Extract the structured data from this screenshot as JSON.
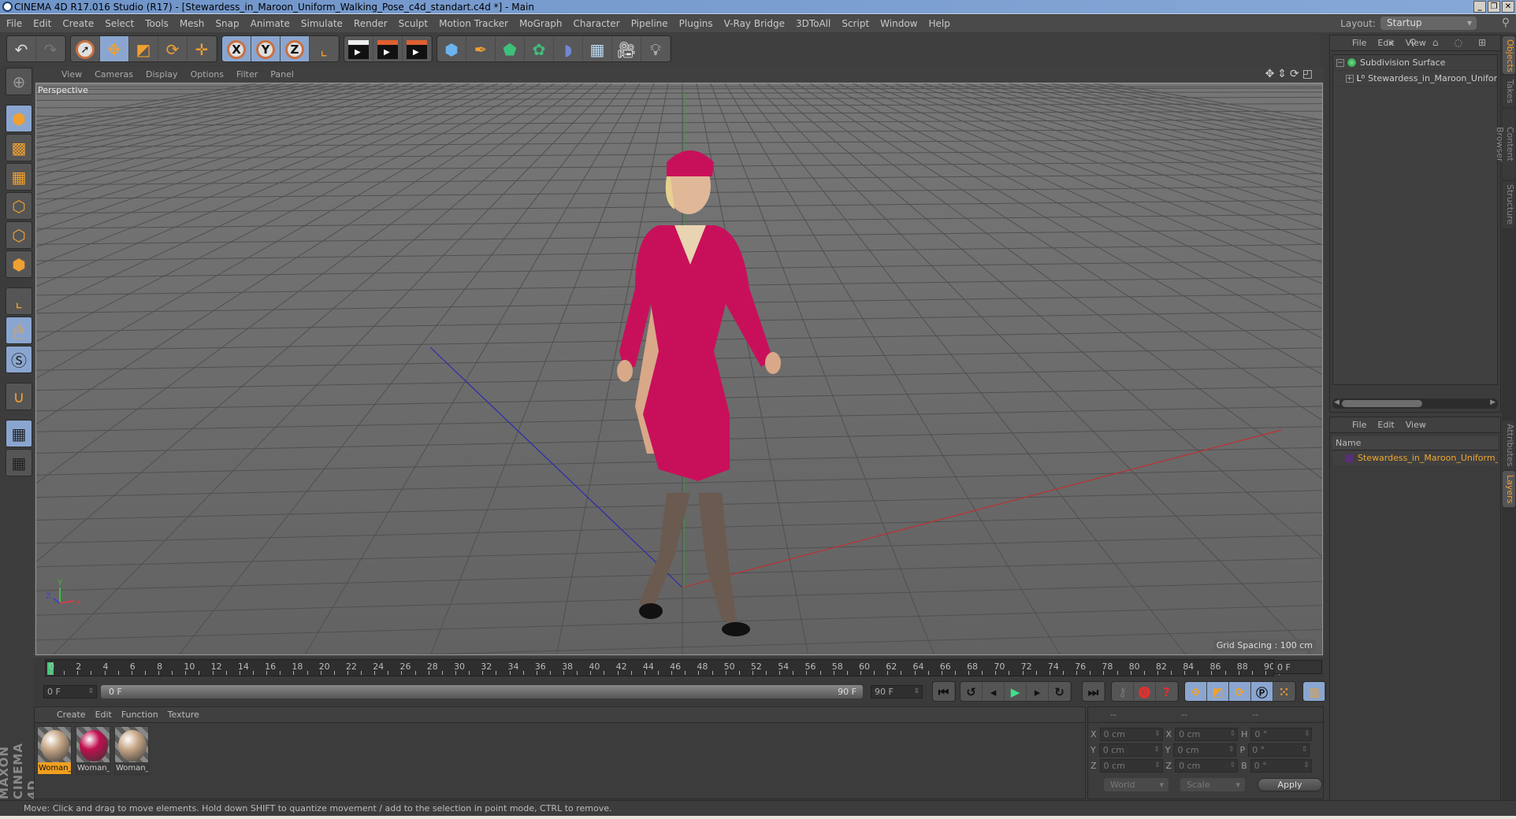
{
  "window": {
    "title": "CINEMA 4D R17.016 Studio (R17) - [Stewardess_in_Maroon_Uniform_Walking_Pose_c4d_standart.c4d *] - Main",
    "controls": [
      "_",
      "❐",
      "✕"
    ]
  },
  "menubar": {
    "items": [
      "File",
      "Edit",
      "Create",
      "Select",
      "Tools",
      "Mesh",
      "Snap",
      "Animate",
      "Simulate",
      "Render",
      "Sculpt",
      "Motion Tracker",
      "MoGraph",
      "Character",
      "Pipeline",
      "Plugins",
      "V-Ray Bridge",
      "3DToAll",
      "Script",
      "Window",
      "Help"
    ],
    "layout_label": "Layout:",
    "layout_value": "Startup"
  },
  "toolbar": {
    "undo": "undo-icon",
    "redo": "redo-icon",
    "tools": [
      "live-selection-icon",
      "move-icon",
      "scale-icon",
      "rotate-icon",
      "add-object-icon"
    ],
    "axes": [
      "X",
      "Y",
      "Z"
    ],
    "coord_system": "world-coordinates-icon",
    "render": [
      "render-view-icon",
      "render-to-picture-viewer-icon",
      "render-settings-icon"
    ],
    "objects": [
      "cube-icon",
      "pen-spline-icon",
      "subdivision-icon",
      "array-icon",
      "deformer-icon",
      "floor-icon",
      "camera-icon",
      "light-icon"
    ]
  },
  "left_tools": [
    "make-editable-icon",
    "model-mode-icon",
    "texture-mode-icon",
    "workplane-icon",
    "points-mode-icon",
    "edges-mode-icon",
    "polygons-mode-icon",
    "axis-mode-icon",
    "tweak-mode-icon",
    "solo-icon",
    "snap-icon",
    "locked-workplane-icon",
    "planar-workplane-icon"
  ],
  "viewport": {
    "menu": [
      "View",
      "Cameras",
      "Display",
      "Options",
      "Filter",
      "Panel"
    ],
    "camera": "Perspective",
    "grid_spacing": "Grid Spacing : 100 cm",
    "nav_icons": [
      "pan-icon",
      "dolly-icon",
      "orbit-icon",
      "maximize-icon"
    ],
    "axis_labels": {
      "x": "X",
      "y": "Y",
      "z": "Z"
    },
    "colors": {
      "uniform": "#c8105a",
      "collar": "#e8d4b0",
      "floor": "#6a6a6a"
    }
  },
  "timeline": {
    "ticks": [
      "0",
      "2",
      "4",
      "6",
      "8",
      "10",
      "12",
      "14",
      "16",
      "18",
      "20",
      "22",
      "24",
      "26",
      "28",
      "30",
      "32",
      "34",
      "36",
      "38",
      "40",
      "42",
      "44",
      "46",
      "48",
      "50",
      "52",
      "54",
      "56",
      "58",
      "60",
      "62",
      "64",
      "66",
      "68",
      "70",
      "72",
      "74",
      "76",
      "78",
      "80",
      "82",
      "84",
      "86",
      "88",
      "90"
    ],
    "current_frame": "0 F",
    "start_field": "0 F",
    "range_start": "0 F",
    "range_end": "90 F",
    "end_field": "90 F"
  },
  "playback": {
    "buttons": [
      "go-to-start-icon",
      "previous-key-icon",
      "previous-frame-icon",
      "play-icon",
      "next-frame-icon",
      "next-key-icon",
      "go-to-end-icon"
    ],
    "record": [
      "motion-record-icon",
      "record-active-objects-icon",
      "autokeying-icon"
    ],
    "keys": [
      "key-position-icon",
      "key-scale-icon",
      "key-rotation-icon",
      "key-parameter-icon",
      "key-pla-icon"
    ],
    "timeline_icon": "timeline-icon"
  },
  "materials": {
    "menu": [
      "Create",
      "Edit",
      "Function",
      "Texture"
    ],
    "items": [
      {
        "label": "Woman_",
        "selected": true,
        "color": "#c8a888"
      },
      {
        "label": "Woman_",
        "selected": false,
        "color": "#c01050"
      },
      {
        "label": "Woman_",
        "selected": false,
        "color": "#c8a888"
      }
    ]
  },
  "brand": "MAXON CINEMA 4D",
  "coordinates": {
    "headers": [
      "--",
      "--",
      "--"
    ],
    "position": {
      "x": "0 cm",
      "y": "0 cm",
      "z": "0 cm"
    },
    "size": {
      "x": "0 cm",
      "y": "0 cm",
      "z": "0 cm"
    },
    "rotation": {
      "h": "0 °",
      "p": "0 °",
      "b": "0 °"
    },
    "labels": {
      "x": "X",
      "y": "Y",
      "z": "Z",
      "h": "H",
      "p": "P",
      "b": "B"
    },
    "mode": "World",
    "type": "Scale",
    "apply": "Apply"
  },
  "objects_panel": {
    "menu": [
      "File",
      "Edit",
      "View"
    ],
    "items": [
      {
        "name": "Subdivision Surface",
        "expander": "−"
      },
      {
        "name": "Stewardess_in_Maroon_Uniform_W",
        "expander": "+"
      }
    ],
    "scroll_fraction": 0.55
  },
  "layers_panel": {
    "menu": [
      "File",
      "Edit",
      "View"
    ],
    "column": "Name",
    "items": [
      {
        "name": "Stewardess_in_Maroon_Uniform_Wa",
        "color": "#5a2e78"
      }
    ],
    "scroll_fraction": 0.4
  },
  "side_tabs": {
    "top": [
      "Objects",
      "Takes",
      "Content Browser",
      "Structure"
    ],
    "bottom": [
      "Attributes",
      "Layers"
    ]
  },
  "status": "Move: Click and drag to move elements. Hold down SHIFT to quantize movement / add to the selection in point mode, CTRL to remove."
}
